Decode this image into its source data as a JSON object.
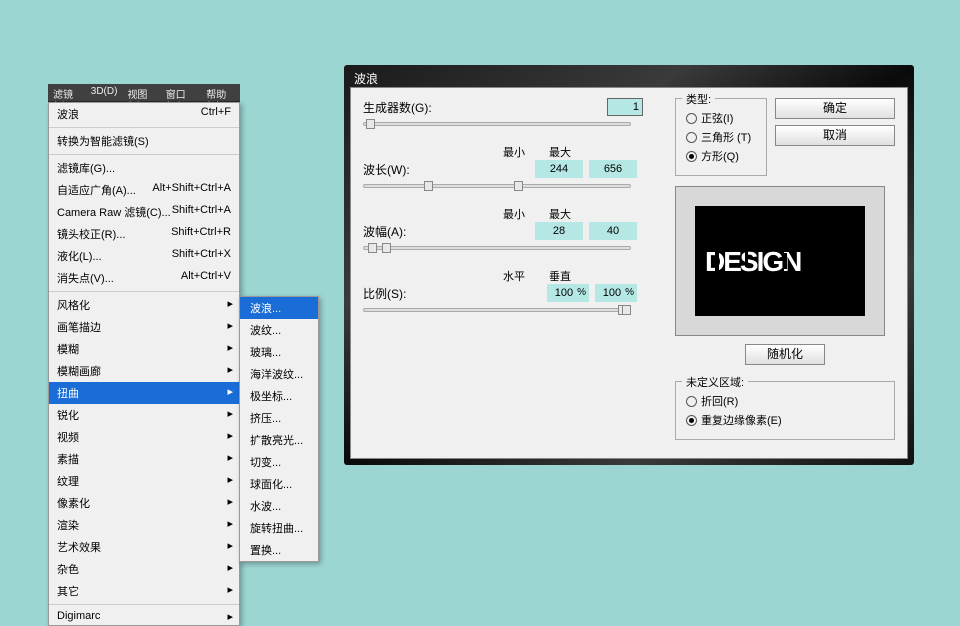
{
  "menubar": [
    "滤镜(T)",
    "3D(D)",
    "视图(V)",
    "窗口(W)",
    "帮助(H)"
  ],
  "dropdown": {
    "top": {
      "label": "波浪",
      "shortcut": "Ctrl+F"
    },
    "smart": "转换为智能滤镜(S)",
    "group1": [
      {
        "label": "滤镜库(G)...",
        "shortcut": ""
      },
      {
        "label": "自适应广角(A)...",
        "shortcut": "Alt+Shift+Ctrl+A"
      },
      {
        "label": "Camera Raw 滤镜(C)...",
        "shortcut": "Shift+Ctrl+A"
      },
      {
        "label": "镜头校正(R)...",
        "shortcut": "Shift+Ctrl+R"
      },
      {
        "label": "液化(L)...",
        "shortcut": "Shift+Ctrl+X"
      },
      {
        "label": "消失点(V)...",
        "shortcut": "Alt+Ctrl+V"
      }
    ],
    "group2": [
      "风格化",
      "画笔描边",
      "模糊",
      "模糊画廊",
      "扭曲",
      "锐化",
      "视频",
      "素描",
      "纹理",
      "像素化",
      "渲染",
      "艺术效果",
      "杂色",
      "其它"
    ],
    "digimarc": "Digimarc"
  },
  "submenu": [
    "波浪...",
    "波纹...",
    "玻璃...",
    "海洋波纹...",
    "极坐标...",
    "挤压...",
    "扩散亮光...",
    "切变...",
    "球面化...",
    "水波...",
    "旋转扭曲...",
    "置换..."
  ],
  "dialog": {
    "title": "波浪",
    "generators_label": "生成器数(G):",
    "generators_value": "1",
    "wavelength_label": "波长(W):",
    "min_label": "最小",
    "max_label": "最大",
    "wavelength_min": "244",
    "wavelength_max": "656",
    "amplitude_label": "波幅(A):",
    "amplitude_min": "28",
    "amplitude_max": "40",
    "scale_label": "比例(S):",
    "horiz_label": "水平",
    "vert_label": "垂直",
    "horiz_val": "100",
    "vert_val": "100",
    "pct": "%",
    "type_title": "类型:",
    "type_sine": "正弦(I)",
    "type_triangle": "三角形 (T)",
    "type_square": "方形(Q)",
    "ok": "确定",
    "cancel": "取消",
    "randomize": "随机化",
    "undefined_title": "未定义区域:",
    "wrap": "折回(R)",
    "repeat_edge": "重复边缘像素(E)",
    "preview_text": "DESIGN"
  }
}
